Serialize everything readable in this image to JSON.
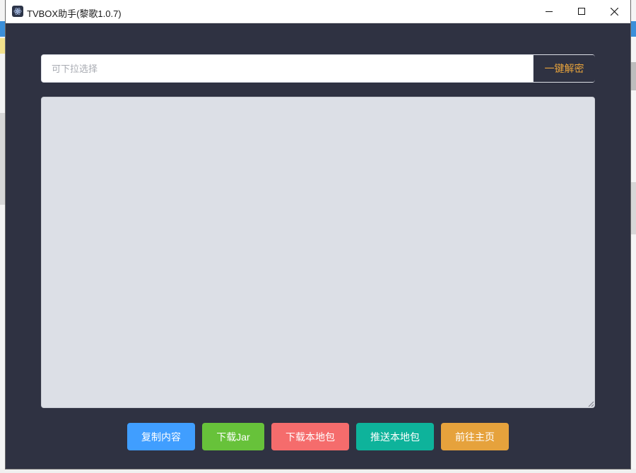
{
  "window": {
    "title": "TVBOX助手(黎歌1.0.7)",
    "icon": "app-logo-icon",
    "controls": [
      "minimize-icon",
      "maximize-icon",
      "close-icon"
    ]
  },
  "selector": {
    "placeholder": "可下拉选择",
    "value": "",
    "decrypt_label": "一键解密"
  },
  "content_area": {
    "value": ""
  },
  "actions": {
    "copy_label": "复制内容",
    "download_jar_label": "下载Jar",
    "download_local_label": "下载本地包",
    "push_local_label": "推送本地包",
    "home_label": "前往主页"
  },
  "colors": {
    "window_bg": "#2f3242",
    "accent": "#e6a23c",
    "copy": "#409eff",
    "jar": "#67c23a",
    "local": "#f56c6c",
    "push": "#0eb39b",
    "home": "#e6a23c"
  }
}
